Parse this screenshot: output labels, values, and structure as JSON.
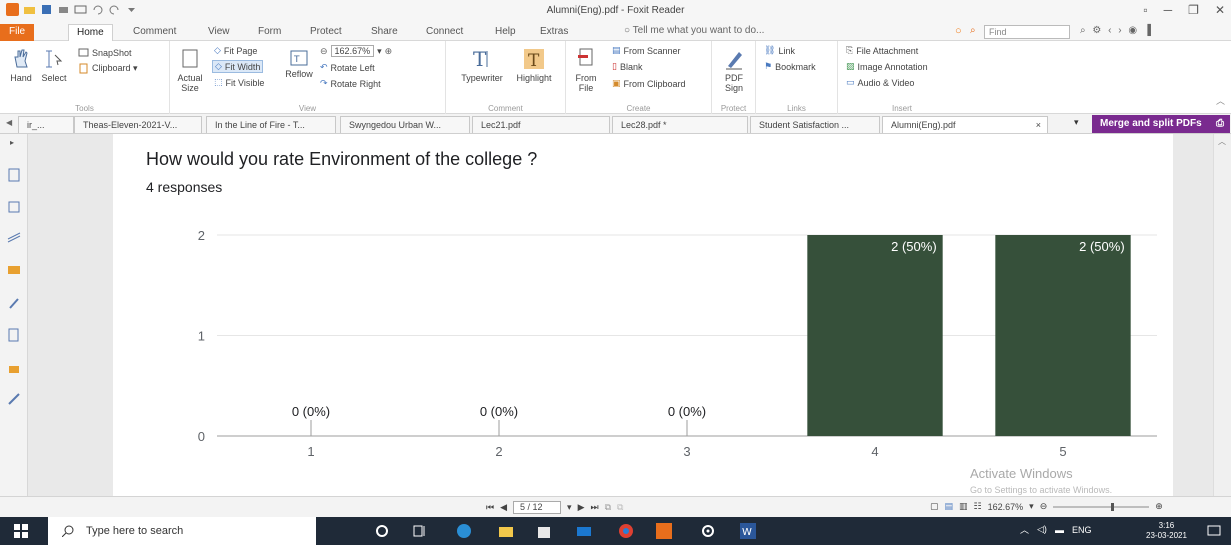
{
  "app": {
    "title": "Alumni(Eng).pdf - Foxit Reader",
    "window_controls": [
      "▫",
      "─",
      "❐",
      "✕"
    ]
  },
  "ribbon_tabs": [
    "File",
    "Home",
    "Comment",
    "View",
    "Form",
    "Protect",
    "Share",
    "Connect",
    "Help",
    "Extras"
  ],
  "tell_me": "Tell me what you want to do...",
  "find_placeholder": "Find",
  "ribbon": {
    "tools": {
      "label": "Tools",
      "hand": "Hand",
      "select": "Select",
      "snapshot": "SnapShot",
      "clipboard": "Clipboard ▾"
    },
    "view": {
      "label": "View",
      "actual_size": "Actual Size",
      "fit_page": "Fit Page",
      "fit_width": "Fit Width",
      "fit_visible": "Fit Visible",
      "reflow": "Reflow",
      "zoom_value": "162.67%",
      "rotate_left": "Rotate Left",
      "rotate_right": "Rotate Right"
    },
    "comment": {
      "label": "Comment",
      "typewriter": "Typewriter",
      "highlight": "Highlight"
    },
    "create": {
      "label": "Create",
      "from_file": "From File",
      "from_scanner": "From Scanner",
      "blank": "Blank",
      "from_clipboard": "From Clipboard"
    },
    "protect": {
      "label": "Protect",
      "pdf_sign": "PDF Sign"
    },
    "links": {
      "label": "Links",
      "link": "Link",
      "bookmark": "Bookmark"
    },
    "insert": {
      "label": "Insert",
      "file_attachment": "File Attachment",
      "image_annotation": "Image Annotation",
      "audio_video": "Audio & Video"
    }
  },
  "doc_tabs": [
    "Theas-Eleven-2021-V...",
    "In the Line of Fire - T...",
    "Swyngedou Urban W...",
    "Lec21.pdf",
    "Lec28.pdf *",
    "Student Satisfaction ...",
    "Alumni(Eng).pdf"
  ],
  "doc_tab_first": "ir_...",
  "merge_button": "Merge and split PDFs",
  "question": {
    "title": "How would you rate Environment of the college ?",
    "responses": "4 responses"
  },
  "chart_data": {
    "type": "bar",
    "categories": [
      "1",
      "2",
      "3",
      "4",
      "5"
    ],
    "values": [
      0,
      0,
      0,
      2,
      2
    ],
    "data_labels": [
      "0 (0%)",
      "0 (0%)",
      "0 (0%)",
      "2 (50%)",
      "2 (50%)"
    ],
    "ylim": [
      0,
      2
    ],
    "yticks": [
      "0",
      "1",
      "2"
    ],
    "bar_color": "#36503a",
    "grid": true
  },
  "watermark": {
    "line1": "Activate Windows",
    "line2": "Go to Settings to activate Windows."
  },
  "status": {
    "page": "5 / 12",
    "zoom": "162.67%"
  },
  "taskbar": {
    "search_placeholder": "Type here to search",
    "language": "ENG",
    "time": "3:16",
    "date": "23-03-2021"
  }
}
